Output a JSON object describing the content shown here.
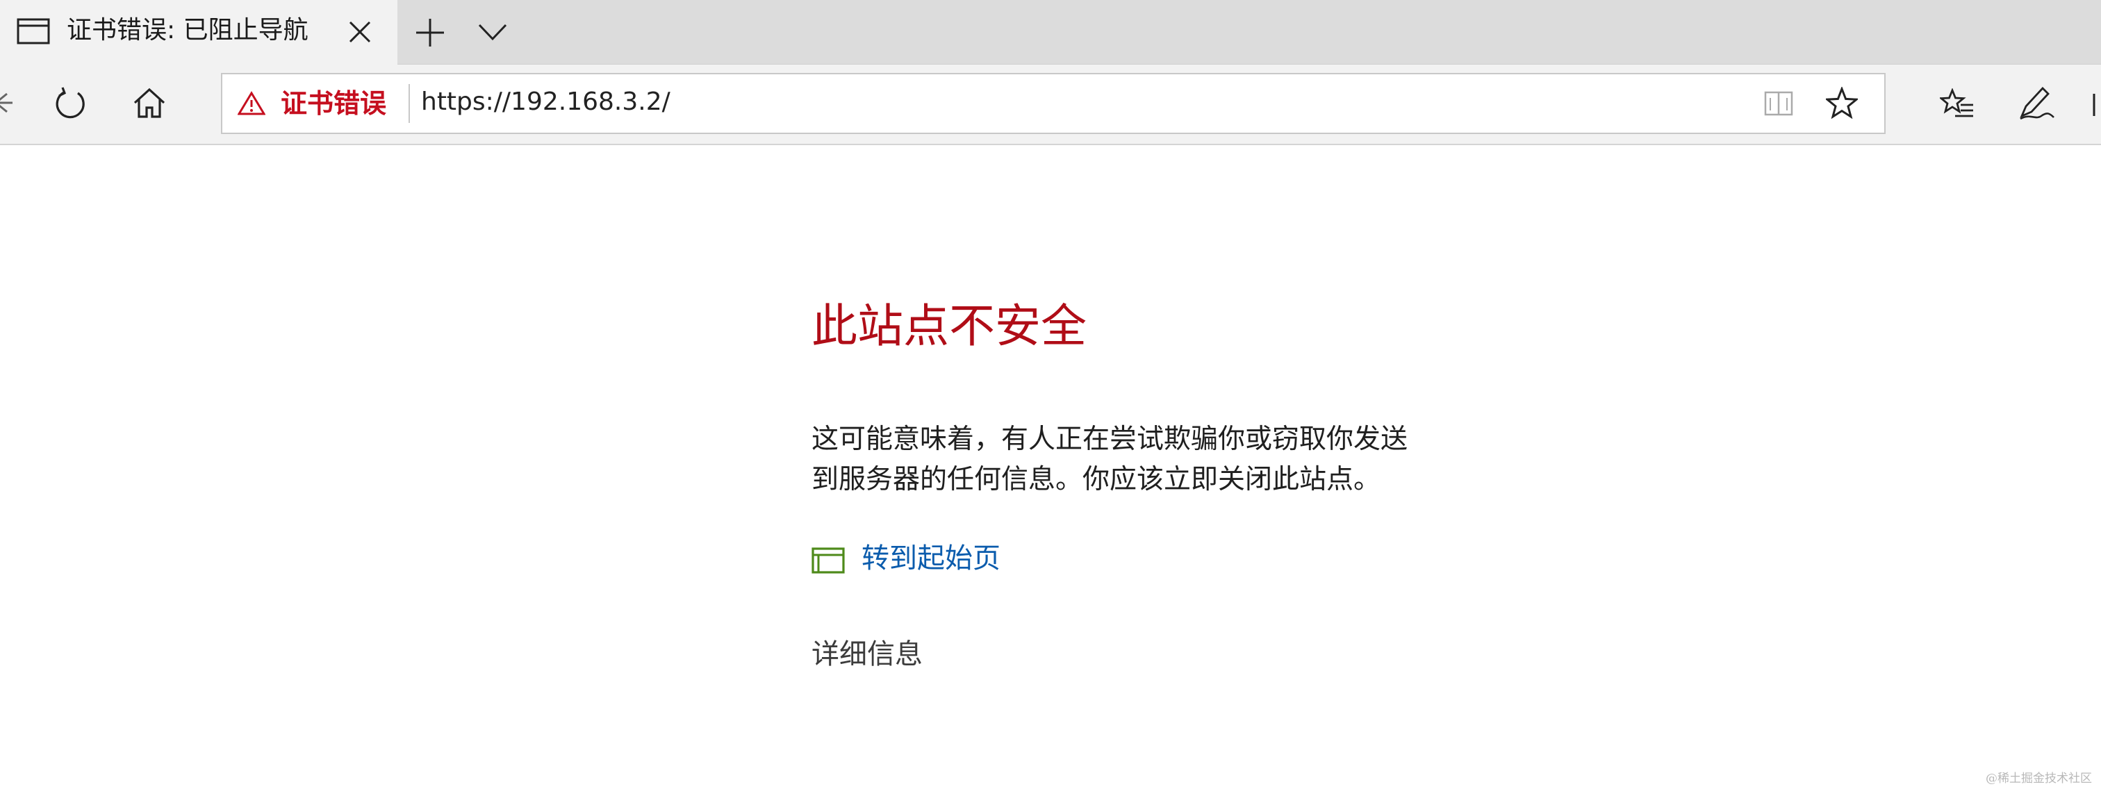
{
  "tab": {
    "title": "证书错误: 已阻止导航",
    "icon": "page-icon"
  },
  "tabbar": {
    "close_icon": "close-icon",
    "new_tab_icon": "plus-icon",
    "tab_list_icon": "chevron-down-icon"
  },
  "navbar": {
    "refresh_icon": "refresh-icon",
    "home_icon": "home-icon",
    "cert_warning_label": "证书错误",
    "url": "https://192.168.3.2/",
    "reading_view_icon": "reading-view-icon",
    "favorite_icon": "star-icon",
    "favorites_hub_icon": "favorites-list-icon",
    "notes_icon": "pen-icon"
  },
  "page": {
    "title": "此站点不安全",
    "message_line1": "这可能意味着，有人正在尝试欺骗你或窃取你发送",
    "message_line2": "到服务器的任何信息。你应该立即关闭此站点。",
    "goto_start_label": "转到起始页",
    "details_label": "详细信息"
  },
  "watermark": "@稀土掘金技术社区",
  "colors": {
    "error_red": "#b00d17",
    "link_blue": "#0b5cad",
    "goto_icon_green": "#4e8a1a"
  }
}
